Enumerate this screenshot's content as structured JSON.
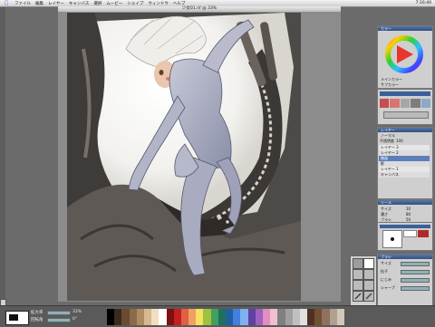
{
  "menubar": {
    "items": [
      "ファイル",
      "編集",
      "レイヤー",
      "キャンバス",
      "選択",
      "ムービー",
      "シェイプ",
      "ウィンドウ",
      "ヘルプ"
    ],
    "clock": "7:16:40"
  },
  "document": {
    "title": "少女01.rif @ 33%"
  },
  "color_panel": {
    "title": "カラー",
    "fields": [
      "メインカラー",
      "サブカラー"
    ]
  },
  "layer_panel": {
    "title": "レイヤー",
    "blend_mode": "ノーマル",
    "opacity_label": "不透明度",
    "opacity_value": "100",
    "layers": [
      "レイヤー 3",
      "レイヤー 2",
      "線画",
      "影",
      "レイヤー 1",
      "キャンバス"
    ]
  },
  "tool_panel": {
    "title": "ツール",
    "rows": [
      {
        "label": "サイズ",
        "value": "10"
      },
      {
        "label": "濃さ",
        "value": "80"
      },
      {
        "label": "ブラシ",
        "value": "50"
      }
    ]
  },
  "brush_panel": {
    "title": "ブラシ",
    "rows": [
      "サイズ",
      "粒子",
      "にじみ",
      "シャープ"
    ]
  },
  "bottom": {
    "zoom": "33%",
    "angle": "0°",
    "rows": [
      "拡大率",
      "回転角"
    ]
  },
  "colors": {
    "accent": "#3d5f9a",
    "swatches": [
      "#000000",
      "#3a2a20",
      "#6b4a30",
      "#8b6a4a",
      "#b08a60",
      "#d8b890",
      "#f0e0c0",
      "#ffffff",
      "#801010",
      "#c02020",
      "#e06040",
      "#f0a060",
      "#f8e060",
      "#a0c040",
      "#40a060",
      "#207060",
      "#2060a0",
      "#4080e0",
      "#80b0f0",
      "#6040a0",
      "#a060c0",
      "#e090c0",
      "#f0c0d0",
      "#808080",
      "#a0a0a0",
      "#c0c0c0",
      "#e0e0e0",
      "#503020",
      "#705030",
      "#907060",
      "#b0a090",
      "#d0c8b8"
    ]
  }
}
